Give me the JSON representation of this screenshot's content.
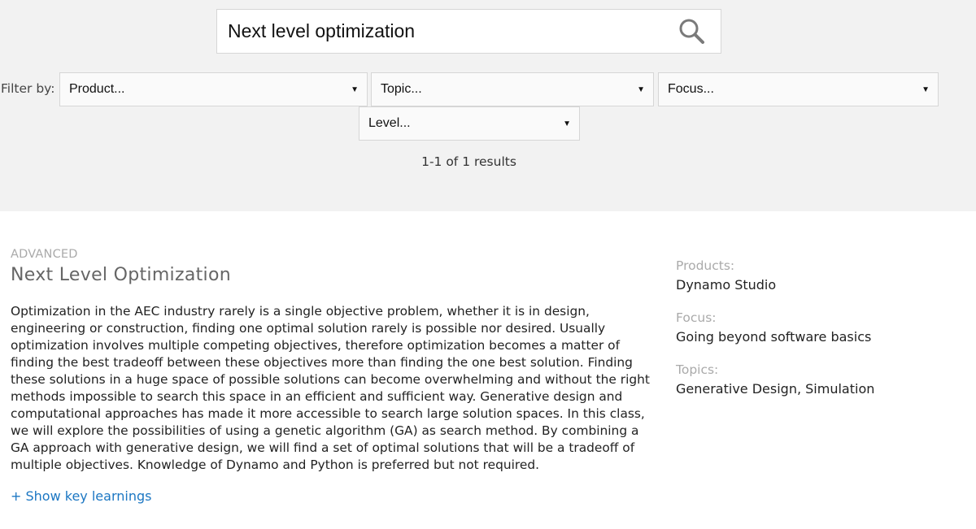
{
  "search": {
    "value": "Next level optimization",
    "icon": "search-icon"
  },
  "filters": {
    "label": "Filter by:",
    "product": {
      "selected": "Product...",
      "icon": "chevron-down-icon"
    },
    "topic": {
      "selected": "Topic...",
      "icon": "chevron-down-icon"
    },
    "focus": {
      "selected": "Focus...",
      "icon": "chevron-down-icon"
    },
    "level": {
      "selected": "Level...",
      "icon": "chevron-down-icon"
    },
    "arrow_glyph": "▼"
  },
  "results_summary": "1-1 of 1 results",
  "results": [
    {
      "level": "ADVANCED",
      "title": "Next Level Optimization",
      "description": "Optimization in the AEC industry rarely is a single objective problem, whether it is in design, engineering or construction, finding one optimal solution rarely is possible nor desired. Usually optimization involves multiple competing objectives, therefore optimization becomes a matter of finding the best tradeoff between these objectives more than finding the one best solution. Finding these solutions in a huge space of possible solutions can become overwhelming and without the right methods impossible to search this space in an efficient and sufficient way. Generative design and computational approaches has made it more accessible to search large solution spaces. In this class, we will explore the possibilities of using a genetic algorithm (GA) as search method. By combining a GA approach with generative design, we will find a set of optimal solutions that will be a tradeoff of multiple objectives. Knowledge of Dynamo and Python is preferred but not required.",
      "show_more_label": "+ Show key learnings",
      "meta": {
        "products_label": "Products:",
        "products_value": "Dynamo Studio",
        "focus_label": "Focus:",
        "focus_value": "Going beyond software basics",
        "topics_label": "Topics:",
        "topics_value": "Generative Design, Simulation"
      }
    }
  ],
  "colors": {
    "header_bg": "#f2f2f2",
    "link": "#1c77c3",
    "muted_label": "#aaaaaa",
    "title": "#666666"
  }
}
